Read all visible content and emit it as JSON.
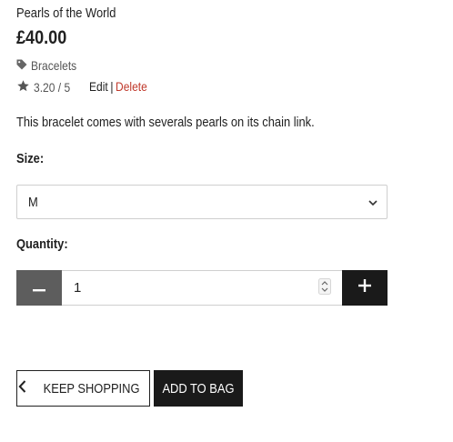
{
  "product": {
    "name": "Pearls of the World",
    "price": "£40.00",
    "category": "Bracelets",
    "rating": "3.20 / 5",
    "description": "This bracelet comes with severals pearls on its chain link."
  },
  "admin": {
    "edit": "Edit",
    "separator": "|",
    "delete": "Delete"
  },
  "size": {
    "label": "Size:",
    "selected": "M"
  },
  "quantity": {
    "label": "Quantity:",
    "value": "1"
  },
  "buttons": {
    "keep_shopping": "KEEP SHOPPING",
    "add_to_bag": "ADD TO BAG"
  },
  "icons": {
    "category": "tag-icon",
    "rating": "star-icon",
    "select": "chevron-down-icon",
    "minus": "minus-icon",
    "plus": "plus-icon",
    "spinner": "spinner-icon",
    "back": "chevron-left-icon"
  },
  "colors": {
    "delete": "#c0392b",
    "dark": "#1a1a1a",
    "minus_bg": "#5d5d5d"
  }
}
